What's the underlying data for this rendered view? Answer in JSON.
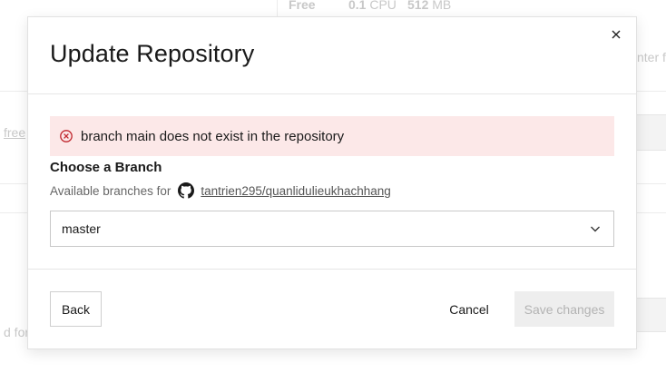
{
  "background": {
    "plan_name": "Free",
    "cpu_value": "0.1",
    "cpu_unit": "CPU",
    "memory_value": "512",
    "memory_unit": "MB",
    "right_fragment": "nter fo",
    "left_fragment_1": "free",
    "left_fragment_2": "d for"
  },
  "modal": {
    "title": "Update Repository",
    "close_icon": "close-icon",
    "error": {
      "icon": "error-circle-x-icon",
      "message": "branch main does not exist in the repository",
      "color": "#fce8e8"
    },
    "branch_section": {
      "title": "Choose a Branch",
      "available_label": "Available branches for",
      "repo_icon": "github-icon",
      "repo_name": "tantrien295/quanlidulieukhachhang",
      "selected_branch": "master"
    },
    "footer": {
      "back_label": "Back",
      "cancel_label": "Cancel",
      "save_label": "Save changes"
    }
  }
}
